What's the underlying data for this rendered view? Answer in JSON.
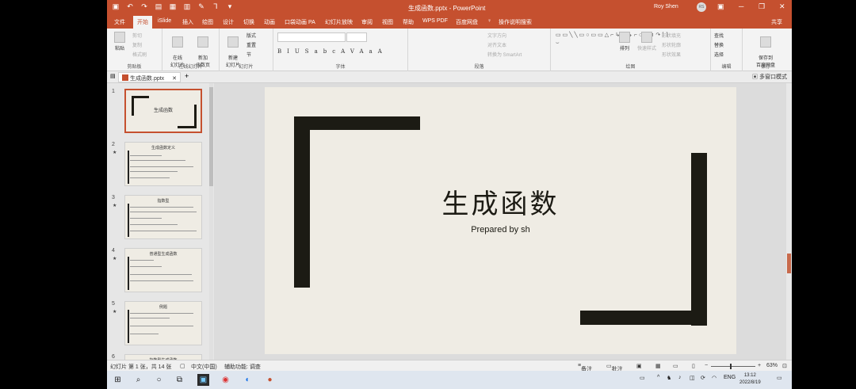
{
  "title": {
    "doc": "生成函数.pptx  -  PowerPoint",
    "user": "Roy Shen",
    "avatar": "RS"
  },
  "tabs": [
    "文件",
    "开始",
    "iSlide",
    "插入",
    "绘图",
    "设计",
    "切换",
    "动画",
    "口袋动画 PA",
    "幻灯片放映",
    "审阅",
    "视图",
    "帮助",
    "WPS PDF",
    "百度网盘",
    "操作说明搜索"
  ],
  "share": "共享",
  "ribbon": {
    "paste": "粘贴",
    "cut": "剪切",
    "copy": "复制",
    "format_painter": "格式刷",
    "clipboard": "剪贴板",
    "online_slides": "在线幻灯片",
    "online": "在线\n幻灯片",
    "new_slide_group": "新加\n函数页",
    "online_group": "在线幻灯片",
    "new_slide": "新建\n幻灯片",
    "layout": "版式",
    "reset": "重置",
    "section": "节",
    "slides_group": "幻灯片",
    "font_group": "字体",
    "paragraph_group": "段落",
    "text_direction": "文字方向",
    "align_text": "对齐文本",
    "smartart": "转换为 SmartArt",
    "drawing_group": "绘图",
    "arrange": "排列",
    "quick_styles": "快速样式",
    "shape_fill": "形状填充",
    "shape_outline": "形状轮廓",
    "shape_effects": "形状效果",
    "find": "查找",
    "replace": "替换",
    "select": "选择",
    "editing_group": "编辑",
    "save_baidu": "保存到\n百度网盘",
    "save_group": "保存"
  },
  "doc_tab": "生成函数.pptx",
  "multi_window": "多窗口模式",
  "thumbnails": [
    {
      "num": "1",
      "title": "生成函数"
    },
    {
      "num": "2",
      "title": "生成函数定义"
    },
    {
      "num": "3",
      "title": "指数型"
    },
    {
      "num": "4",
      "title": "普通型生成函数"
    },
    {
      "num": "5",
      "title": "例题"
    },
    {
      "num": "6",
      "title": "指数型生成函数"
    }
  ],
  "slide": {
    "title": "生成函数",
    "subtitle": "Prepared by sh"
  },
  "status": {
    "slide_info": "幻灯片 第 1 张，共 14 张",
    "language": "中文(中国)",
    "accessibility": "辅助功能: 调查",
    "notes": "备注",
    "comments": "批注",
    "zoom": "63%"
  },
  "taskbar": {
    "lang": "ENG",
    "time": "13:12",
    "date": "2022/8/19"
  },
  "colors": {
    "accent": "#c5502f",
    "slide_bg": "#efece4",
    "bracket": "#1c1b14"
  }
}
